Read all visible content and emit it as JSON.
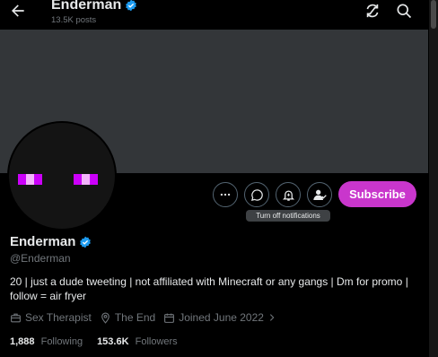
{
  "header": {
    "title": "Enderman",
    "posts_count": "13.5K posts"
  },
  "actions": {
    "tooltip": "Turn off notifications",
    "subscribe_label": "Subscribe"
  },
  "profile": {
    "display_name": "Enderman",
    "handle": "@Enderman",
    "bio": "20 | just a dude tweeting | not affiliated with Minecraft or any gangs | Dm for promo | follow = air fryer",
    "profession": "Sex Therapist",
    "location": "The End",
    "joined": "Joined June 2022",
    "following_count": "1,888",
    "following_label": "Following",
    "followers_count": "153.6K",
    "followers_label": "Followers"
  },
  "colors": {
    "accent": "#c936cc",
    "verified": "#1d9bf0",
    "banner": "#333639",
    "muted": "#71767b"
  },
  "icons": {
    "back": "arrow-left-icon",
    "refresh": "refresh-icon",
    "search": "search-icon",
    "more": "more-icon",
    "message": "message-icon",
    "notifications": "bell-icon",
    "follow": "person-check-icon",
    "verified": "verified-badge-icon",
    "profession": "briefcase-icon",
    "location": "location-pin-icon",
    "calendar": "calendar-icon"
  }
}
